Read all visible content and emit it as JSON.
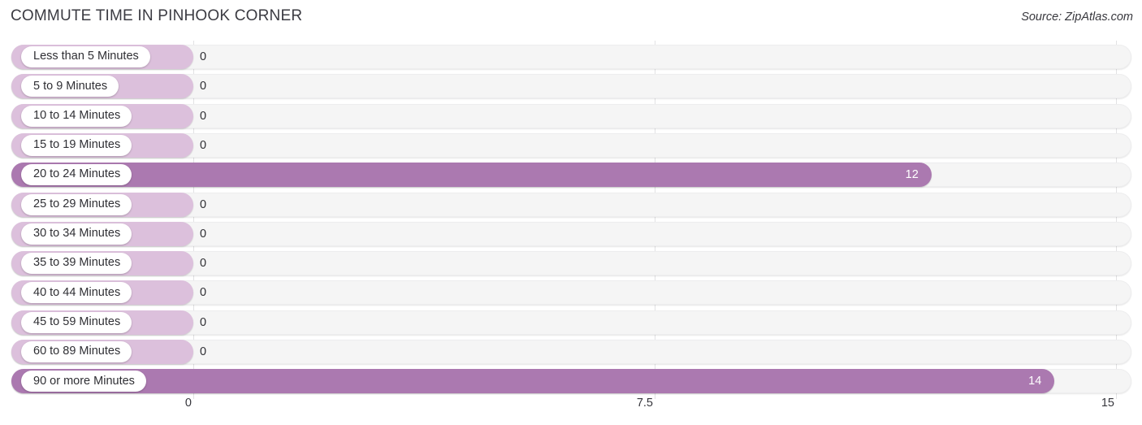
{
  "header": {
    "title": "COMMUTE TIME IN PINHOOK CORNER",
    "source": "Source: ZipAtlas.com"
  },
  "colors": {
    "bar_light": "#dcc0dc",
    "bar_dark": "#ab79b0",
    "track": "#f5f5f5",
    "gridline": "#e2e2e4",
    "label_text": "#2f2f34",
    "value_text_inside": "#ffffff"
  },
  "chart_data": {
    "type": "bar",
    "orientation": "horizontal",
    "title": "COMMUTE TIME IN PINHOOK CORNER",
    "xlabel": "",
    "ylabel": "",
    "xlim": [
      0,
      15
    ],
    "grid": true,
    "legend": null,
    "xticks": [
      "0",
      "7.5",
      "15"
    ],
    "xtick_values": [
      0,
      7.5,
      15
    ],
    "categories": [
      "Less than 5 Minutes",
      "5 to 9 Minutes",
      "10 to 14 Minutes",
      "15 to 19 Minutes",
      "20 to 24 Minutes",
      "25 to 29 Minutes",
      "30 to 34 Minutes",
      "35 to 39 Minutes",
      "40 to 44 Minutes",
      "45 to 59 Minutes",
      "60 to 89 Minutes",
      "90 or more Minutes"
    ],
    "values": [
      0,
      0,
      0,
      0,
      12,
      0,
      0,
      0,
      0,
      0,
      0,
      14
    ],
    "value_labels": [
      "0",
      "0",
      "0",
      "0",
      "12",
      "0",
      "0",
      "0",
      "0",
      "0",
      "0",
      "14"
    ]
  }
}
